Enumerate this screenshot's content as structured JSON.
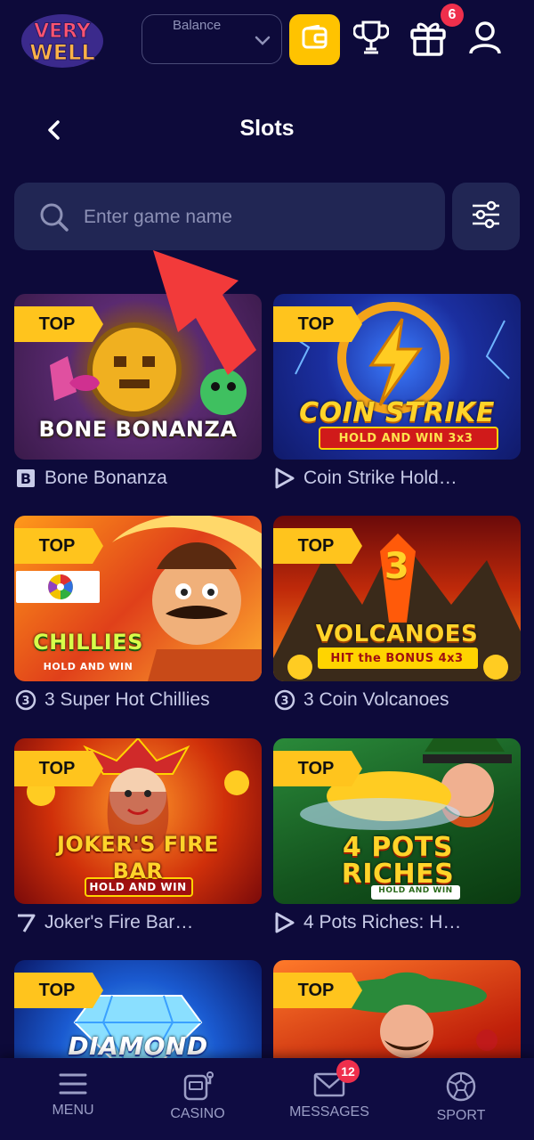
{
  "header": {
    "logo_line1": "VERY",
    "logo_line2": "WELL",
    "balance_label": "Balance",
    "gift_badge": "6"
  },
  "page": {
    "title": "Slots"
  },
  "search": {
    "placeholder": "Enter game name"
  },
  "games": [
    {
      "name": "Bone Bonanza",
      "badge": "TOP",
      "art_title": "BONE BONANZA",
      "provider_icon": "b-provider-icon"
    },
    {
      "name": "Coin Strike Hold…",
      "badge": "TOP",
      "art_title": "COIN STRIKE",
      "art_sub": "HOLD AND WIN 3x3",
      "provider_icon": "play-provider-icon"
    },
    {
      "name": "3 Super Hot Chillies",
      "badge": "TOP",
      "art_title": "CHILLIES",
      "art_sub": "HOLD AND WIN",
      "provider_icon": "3oaks-provider-icon"
    },
    {
      "name": "3 Coin Volcanoes",
      "badge": "TOP",
      "art_title": "VOLCANOES",
      "art_sub": "HIT the BONUS 4x3",
      "provider_icon": "3oaks-provider-icon"
    },
    {
      "name": "Joker's Fire Bar…",
      "badge": "TOP",
      "art_title": "JOKER'S FIRE BAR",
      "art_sub": "HOLD AND WIN",
      "provider_icon": "seven-provider-icon"
    },
    {
      "name": "4 Pots Riches: H…",
      "badge": "TOP",
      "art_title": "4 POTS RICHES",
      "art_sub": "HOLD AND WIN",
      "provider_icon": "play-provider-icon"
    },
    {
      "name": "",
      "badge": "TOP",
      "art_title": "DIAMOND"
    },
    {
      "name": "",
      "badge": "TOP",
      "art_title": ""
    }
  ],
  "bottom_nav": {
    "menu": "MENU",
    "casino": "CASINO",
    "messages": "MESSAGES",
    "messages_badge": "12",
    "sport": "SPORT"
  },
  "colors": {
    "background": "#0d0a3a",
    "accent_yellow": "#ffc300",
    "badge_red": "#ef2f4c",
    "panel": "#212654"
  }
}
